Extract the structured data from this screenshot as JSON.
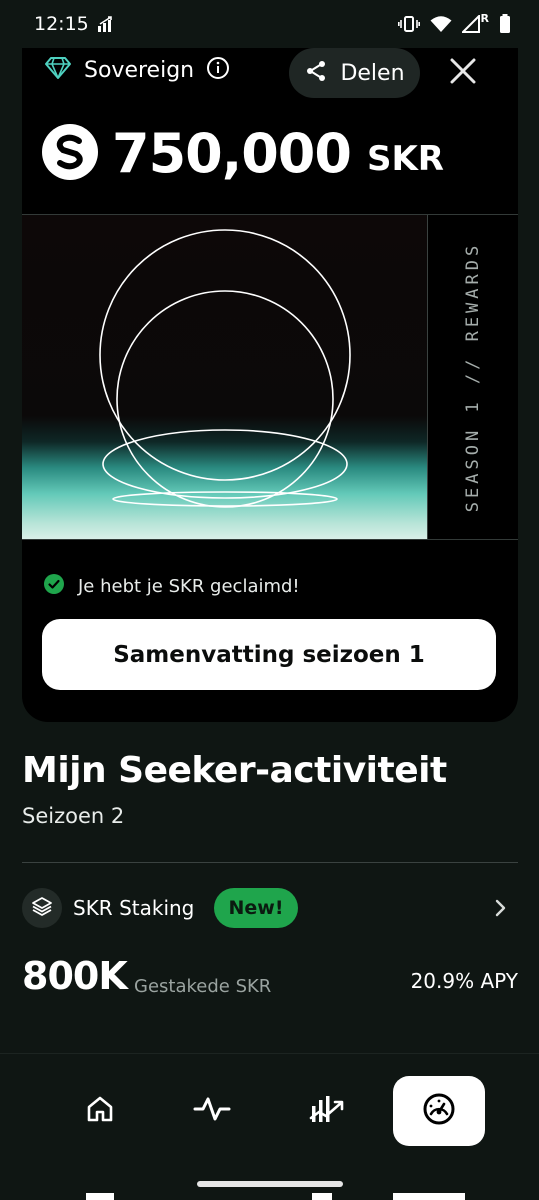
{
  "status_bar": {
    "time": "12:15",
    "network_badge": "R"
  },
  "card": {
    "tier_label": "Sovereign",
    "share_label": "Delen",
    "amount": "750,000",
    "unit": "SKR",
    "art_label": "SEASON 1 // REWARDS",
    "claimed_text": "Je hebt je SKR geclaimd!",
    "summary_button": "Samenvatting seizoen 1"
  },
  "activity": {
    "title": "Mijn Seeker-activiteit",
    "season": "Seizoen 2",
    "staking": {
      "label": "SKR Staking",
      "badge": "New!",
      "value": "800K",
      "caption": "Gestakede SKR",
      "apy": "20.9% APY"
    }
  },
  "nav": {
    "items": [
      {
        "name": "home-icon",
        "active": false
      },
      {
        "name": "activity-icon",
        "active": false
      },
      {
        "name": "trending-chart-icon",
        "active": false
      },
      {
        "name": "dashboard-gauge-icon",
        "active": true
      }
    ]
  },
  "colors": {
    "background": "#0f1613",
    "card": "#000000",
    "accent_green": "#1fa54c",
    "teal_glow": "#63c9b8"
  }
}
